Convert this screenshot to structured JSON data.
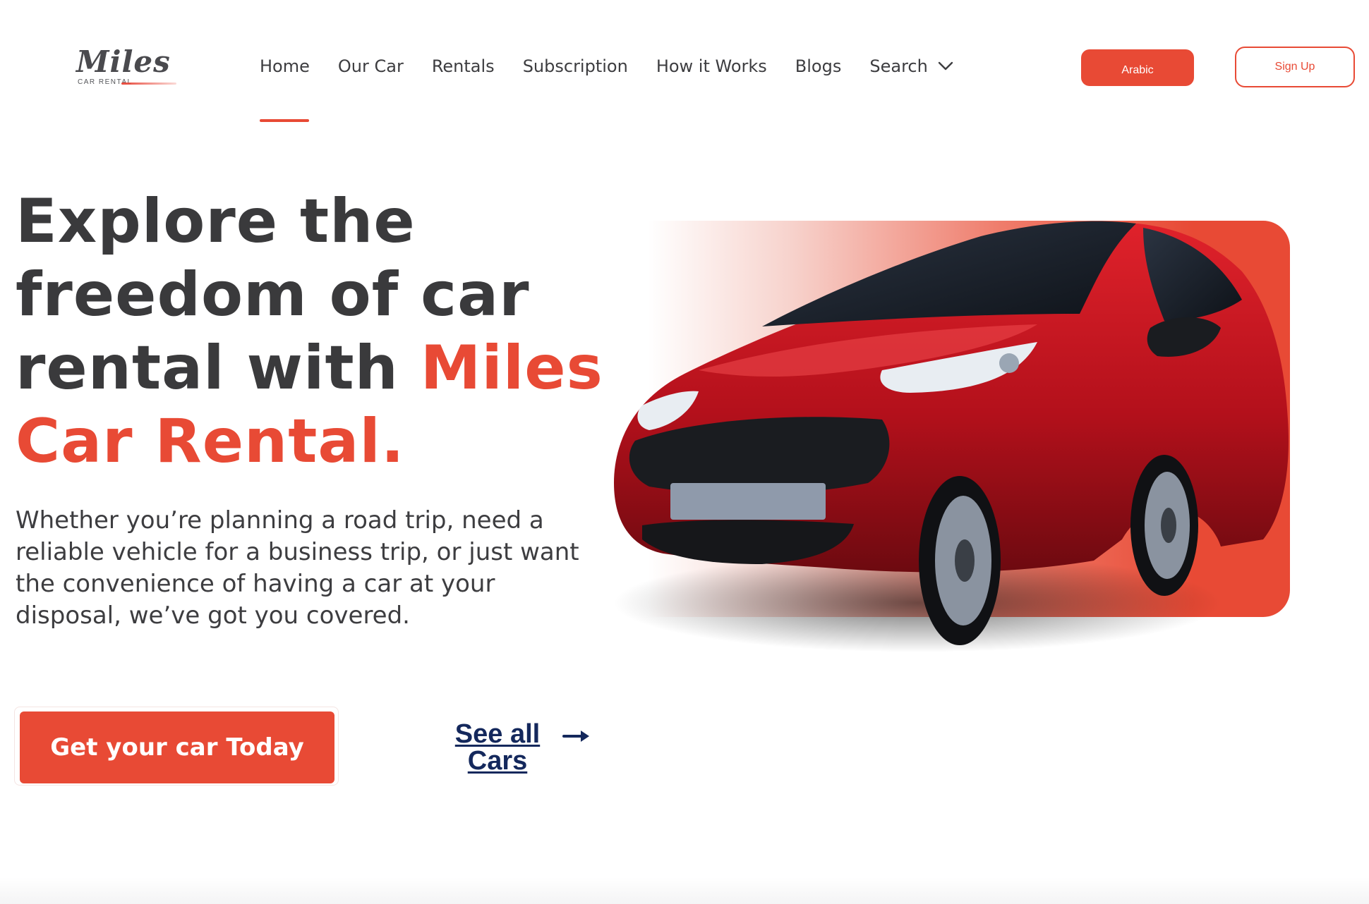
{
  "brand": {
    "logo_word": "Miles",
    "logo_sub": "CAR RENTAL",
    "accent_color": "#e84a35",
    "text_color": "#3a3a3c",
    "link_color": "#14285c"
  },
  "nav": {
    "items": [
      {
        "label": "Home",
        "active": true
      },
      {
        "label": "Our Car"
      },
      {
        "label": "Rentals"
      },
      {
        "label": "Subscription"
      },
      {
        "label": "How it Works"
      },
      {
        "label": "Blogs"
      },
      {
        "label": "Search",
        "icon": "chevron-down-icon"
      }
    ]
  },
  "header": {
    "arabic_label": "Arabic",
    "signup_label": "Sign Up"
  },
  "hero": {
    "title_line1": "Explore the",
    "title_line2": "freedom of car",
    "title_line3_plain": "rental with ",
    "title_line3_accent": "Miles",
    "title_line4_accent": "Car Rental.",
    "description": "Whether you’re planning a road trip, need a reliable vehicle for a business trip, or just want the convenience of having a car at your disposal, we’ve got you covered.",
    "cta_label": "Get your car Today",
    "see_all_label": "See all Cars",
    "see_all_icon": "arrow-right-icon",
    "image": "red-hatchback-car-image"
  }
}
